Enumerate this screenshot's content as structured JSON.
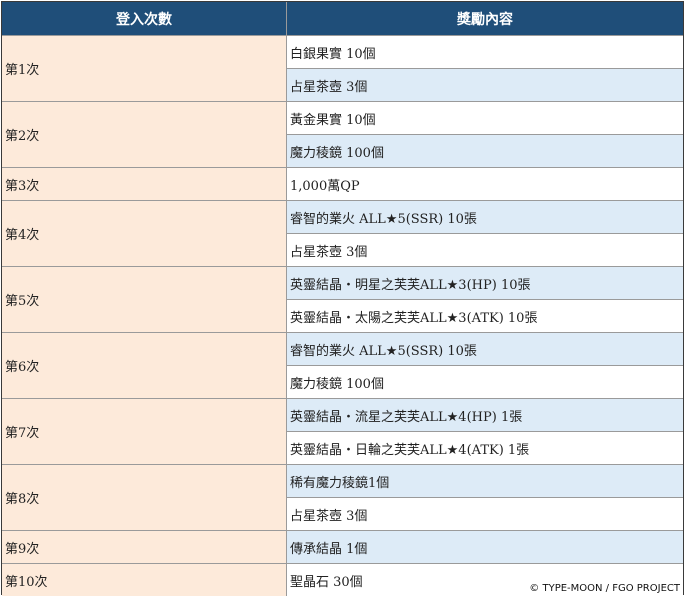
{
  "header": {
    "login_count": "登入次數",
    "reward_content": "獎勵內容"
  },
  "rows": [
    {
      "day": "第1次",
      "rewards": [
        {
          "text": "白銀果實 10個",
          "highlight": false
        },
        {
          "text": "占星茶壺 3個",
          "highlight": false
        }
      ]
    },
    {
      "day": "第2次",
      "rewards": [
        {
          "text": "黃金果實 10個",
          "highlight": false
        },
        {
          "text": "魔力稜鏡 100個",
          "highlight": false
        }
      ]
    },
    {
      "day": "第3次",
      "rewards": [
        {
          "text": "1,000萬QP",
          "highlight": false
        }
      ]
    },
    {
      "day": "第4次",
      "rewards": [
        {
          "text": "睿智的業火 ALL★5(SSR) 10張",
          "highlight": false
        },
        {
          "text": "占星茶壺 3個",
          "highlight": false
        }
      ]
    },
    {
      "day": "第5次",
      "rewards": [
        {
          "text": "英靈結晶・明星之芙芙ALL★3(HP) 10張",
          "highlight": false
        },
        {
          "text": "英靈結晶・太陽之芙芙ALL★3(ATK) 10張",
          "highlight": false
        }
      ]
    },
    {
      "day": "第6次",
      "rewards": [
        {
          "text": "睿智的業火 ALL★5(SSR) 10張",
          "highlight": false
        },
        {
          "text": "魔力稜鏡 100個",
          "highlight": false
        }
      ]
    },
    {
      "day": "第7次",
      "rewards": [
        {
          "text": "英靈結晶・流星之芙芙ALL★4(HP) 1張",
          "highlight": false
        },
        {
          "text": "英靈結晶・日輪之芙芙ALL★4(ATK) 1張",
          "highlight": false
        }
      ]
    },
    {
      "day": "第8次",
      "rewards": [
        {
          "text": "稀有魔力稜鏡1個",
          "highlight": true
        },
        {
          "text": "占星茶壺 3個",
          "highlight": false
        }
      ]
    },
    {
      "day": "第9次",
      "rewards": [
        {
          "text": "傳承結晶 1個",
          "highlight": true
        }
      ]
    },
    {
      "day": "第10次",
      "rewards": [
        {
          "text": "聖晶石 30個",
          "highlight": true
        }
      ]
    }
  ],
  "footer": {
    "copyright": "© TYPE-MOON / FGO PROJECT"
  },
  "colors": {
    "header_bg": "#1f4e79",
    "login_bg": "#fdeada",
    "row_alt_bg": "#ddebf7",
    "highlight_text": "#e8312f"
  }
}
